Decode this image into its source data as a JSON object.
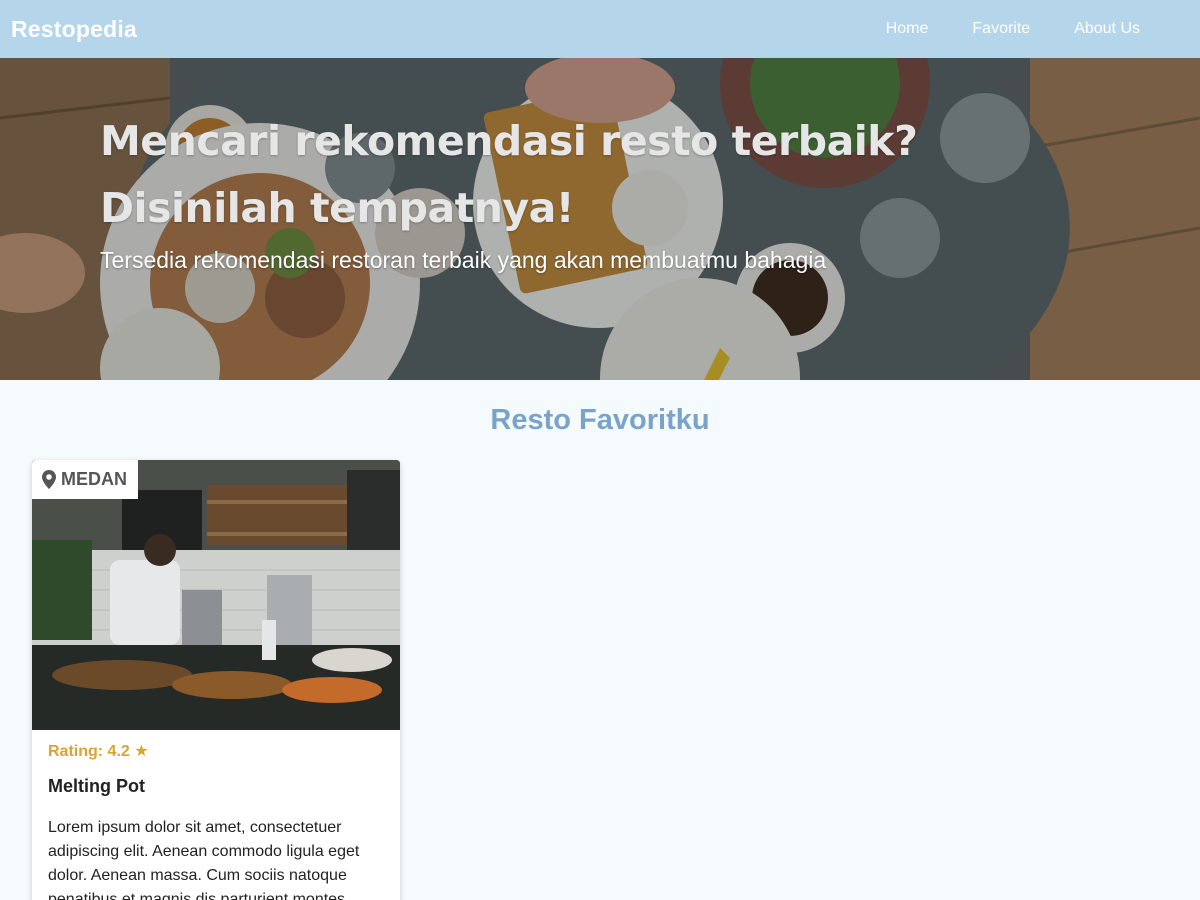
{
  "navbar": {
    "brand": "Restopedia",
    "links": [
      "Home",
      "Favorite",
      "About Us"
    ]
  },
  "hero": {
    "title": "Mencari rekomendasi resto terbaik? Disinilah tempatnya!",
    "subtitle": "Tersedia rekomendasi restoran terbaik yang akan membuatmu bahagia"
  },
  "section": {
    "title": "Resto Favoritku"
  },
  "restaurants": [
    {
      "city": "MEDAN",
      "rating_text": "Rating: 4.2 ★",
      "rating": 4.2,
      "name": "Melting Pot",
      "description": "Lorem ipsum dolor sit amet, consectetuer adipiscing elit. Aenean commodo ligula eget dolor. Aenean massa. Cum sociis natoque penatibus et magnis dis parturient montes,"
    }
  ],
  "icons": {
    "location": "map-marker-icon",
    "star": "star-icon"
  },
  "colors": {
    "navbar_bg": "#b5d5ea",
    "section_title": "#7aa3cc",
    "rating": "#d8a52e",
    "page_bg": "#f5fafc"
  }
}
